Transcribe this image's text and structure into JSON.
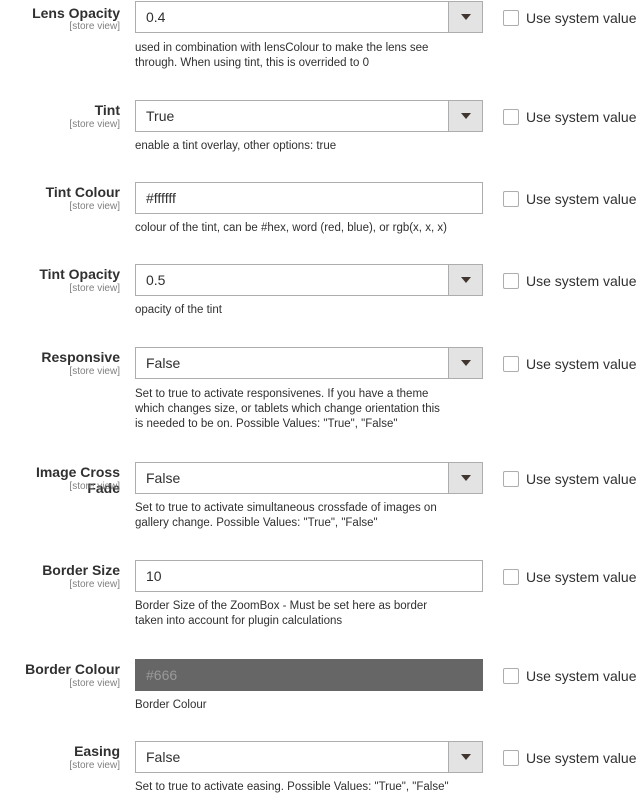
{
  "scope_label": "[store view]",
  "use_system_label": "Use system value",
  "fields": [
    {
      "label": "Lens Opacity",
      "type": "select",
      "value": "0.4",
      "note_lines": [
        "used in combination with lensColour to make the lens see",
        "through. When using tint, this is overrided to 0"
      ]
    },
    {
      "label": "Tint",
      "type": "select",
      "value": "True",
      "note_lines": [
        "enable a tint overlay, other options: true"
      ]
    },
    {
      "label": "Tint Colour",
      "type": "text",
      "value": "#ffffff",
      "note_lines": [
        "colour of the tint, can be #hex, word (red, blue), or rgb(x, x, x)"
      ]
    },
    {
      "label": "Tint Opacity",
      "type": "select",
      "value": "0.5",
      "note_lines": [
        "opacity of the tint"
      ]
    },
    {
      "label": "Responsive",
      "type": "select",
      "value": "False",
      "note_lines": [
        "Set to true to activate responsivenes. If you have a theme",
        "which changes size, or tablets which change orientation this",
        "is needed to be on. Possible Values: \"True\", \"False\""
      ]
    },
    {
      "label": "Image Cross Fade",
      "type": "select",
      "value": "False",
      "note_lines": [
        "Set to true to activate simultaneous crossfade of images on",
        "gallery change. Possible Values: \"True\", \"False\""
      ]
    },
    {
      "label": "Border Size",
      "type": "text",
      "value": "10",
      "note_lines": [
        "Border Size of the ZoomBox - Must be set here as border",
        "taken into account for plugin calculations"
      ]
    },
    {
      "label": "Border Colour",
      "type": "color",
      "value": "#666",
      "note_lines": [
        "Border Colour"
      ]
    },
    {
      "label": "Easing",
      "type": "select",
      "value": "False",
      "note_lines": [
        "Set to true to activate easing. Possible Values: \"True\", \"False\""
      ]
    }
  ],
  "colors": {
    "border_colour_swatch": "#666666",
    "select_arrow_bg": "#e3e3e3",
    "input_border": "#adadad"
  }
}
